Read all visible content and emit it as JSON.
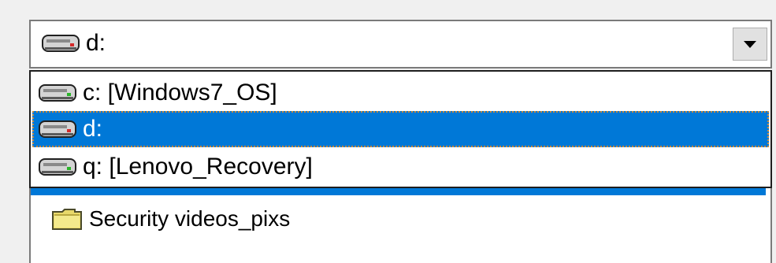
{
  "drive_combo": {
    "selected_value": "d:",
    "icon": "hard-drive-icon",
    "dropdown_icon": "chevron-down-icon"
  },
  "drive_list": {
    "options": [
      {
        "label": "c: [Windows7_OS]",
        "icon": "hard-drive-icon",
        "selected": false
      },
      {
        "label": "d:",
        "icon": "hard-drive-icon",
        "selected": true
      },
      {
        "label": "q: [Lenovo_Recovery]",
        "icon": "hard-drive-icon",
        "selected": false
      }
    ]
  },
  "file_list": {
    "items": [
      {
        "label": "Security videos_pixs",
        "icon": "folder-icon"
      }
    ]
  },
  "colors": {
    "selection": "#0078d7",
    "focus_dots": "#c88a3a",
    "background": "#f0f0f0"
  }
}
